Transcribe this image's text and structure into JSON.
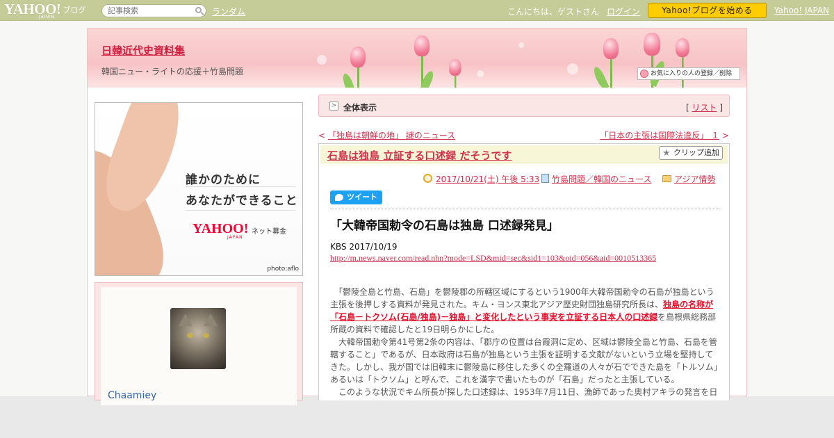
{
  "topbar": {
    "logo_text": "YAHOO!",
    "logo_sub": "JAPAN",
    "logo_blog": "ブログ",
    "search_placeholder": "記事検索",
    "random_link": "ランダム",
    "greeting": "こんにちは、ゲストさん",
    "login_link": "ログイン",
    "start_button": "Yahoo!ブログを始める",
    "yahoo_japan_link": "Yahoo! JAPAN"
  },
  "header": {
    "blog_title": "日韓近代史資料集",
    "blog_description": "韓国ニュー・ライトの応援＋竹島問題",
    "favorite_button": "お気に入りの人の登録／削除"
  },
  "sidebar": {
    "ad": {
      "line1": "誰かのために",
      "line2": "あなたができること",
      "brand": "YAHOO!",
      "brand_sub": "JAPAN",
      "service": "ネット募金",
      "credit": "photo:aflo"
    },
    "profile": {
      "name": "Chaamiey"
    }
  },
  "main": {
    "view_label": "全体表示",
    "list_bracket_open": "[",
    "list_link": "リスト",
    "list_bracket_close": "]",
    "prev_arrow": "<",
    "prev_article": "「独島は朝鮮の地」 謎のニュース",
    "next_article": "「日本の主張は国際法違反」 １",
    "next_arrow": ">",
    "article": {
      "title": "石島は独島 立証する口述録 だそうです",
      "clip_button": "クリップ追加",
      "date": "2017/10/21(土) 午後 5:33",
      "category": "竹島問題／韓国のニュース",
      "folder": "アジア情勢",
      "tweet_button": "ツイート",
      "headline": "「大韓帝国勅令の石島は独島 口述録発見」",
      "source": "KBS 2017/10/19",
      "url": "http://m.news.naver.com/read.nhn?mode=LSD&mid=sec&sid1=103&oid=056&aid=0010513365",
      "para1_a": "　「鬱陵全島と竹島、石島」を鬱陵郡の所轄区域にするという1900年大韓帝国勅令の石島が独島という主張を後押しする資料が発見された。キム・ヨンス東北アジア歴史財団独島研究所長は、",
      "para1_highlight": "独島の名称が「石島－トクソム(石島/独島)－独島」と変化したという事実を立証する日本人の口述録",
      "para1_b": "を島根県総務部所蔵の資料で確認したと19日明らかにした。",
      "para2": "　大韓帝国勅令第41号第2条の内容は、「郡庁の位置は台霞洞に定め、区域は鬱陵全島と竹島、石島を管轄すること」であるが、日本政府は石島が独島という主張を証明する文献がないという立場を堅持してきた。しかし、我が国では旧韓末に鬱陵島に移住した多くの全羅道の人々が石でできた島を「トルソム」あるいは「トクソム」と呼んで、これを漢字で書いたものが「石島」だったと主張している。",
      "para3": "　このような状況でキム所長が探した口述録は、1953年7月11日、漁師であった奥村アキラの発言を日"
    }
  },
  "colors": {
    "topbar": "#c6cc98",
    "accent": "#d0314c",
    "highlight": "#e8112d",
    "start_button": "#ffcc00",
    "tweet": "#1da1f2"
  },
  "icons": [
    "search-icon",
    "tulip-decoration",
    "favorite-icon",
    "view-toggle-icon",
    "star-icon",
    "clock-icon",
    "book-icon",
    "folder-icon",
    "twitter-bird-icon"
  ]
}
